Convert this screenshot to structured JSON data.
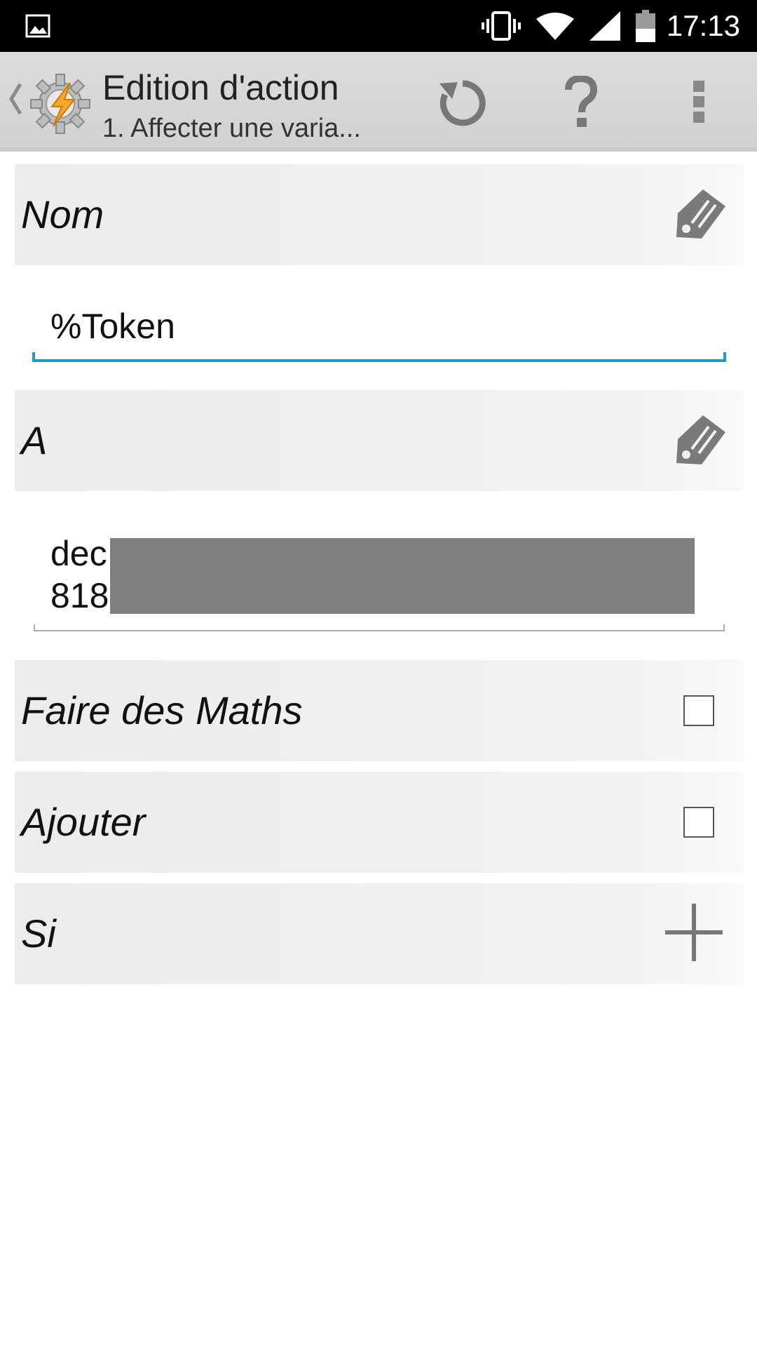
{
  "status_bar": {
    "time": "17:13",
    "icons": [
      "image-notification-icon",
      "vibrate-icon",
      "wifi-icon",
      "signal-icon",
      "battery-icon"
    ]
  },
  "action_bar": {
    "title": "Edition d'action",
    "subtitle": "1. Affecter une varia...",
    "icons": [
      "back-chevron-icon",
      "tasker-app-icon",
      "refresh-icon",
      "help-icon",
      "overflow-menu-icon"
    ]
  },
  "form": {
    "nom": {
      "label": "Nom",
      "value": "%Token",
      "action_icon": "edit-tag-icon"
    },
    "a": {
      "label": "A",
      "value_line1": "dec",
      "value_line2": "818",
      "action_icon": "edit-tag-icon"
    },
    "faire_des_maths": {
      "label": "Faire des Maths",
      "checked": false
    },
    "ajouter": {
      "label": "Ajouter",
      "checked": false
    },
    "si": {
      "label": "Si",
      "action_icon": "plus-icon"
    }
  },
  "colors": {
    "accent": "#1d9bc5",
    "statusbar": "#000000",
    "actionbar": "#d6d6d6",
    "row_bg": "#ececec",
    "redaction": "#808080"
  }
}
